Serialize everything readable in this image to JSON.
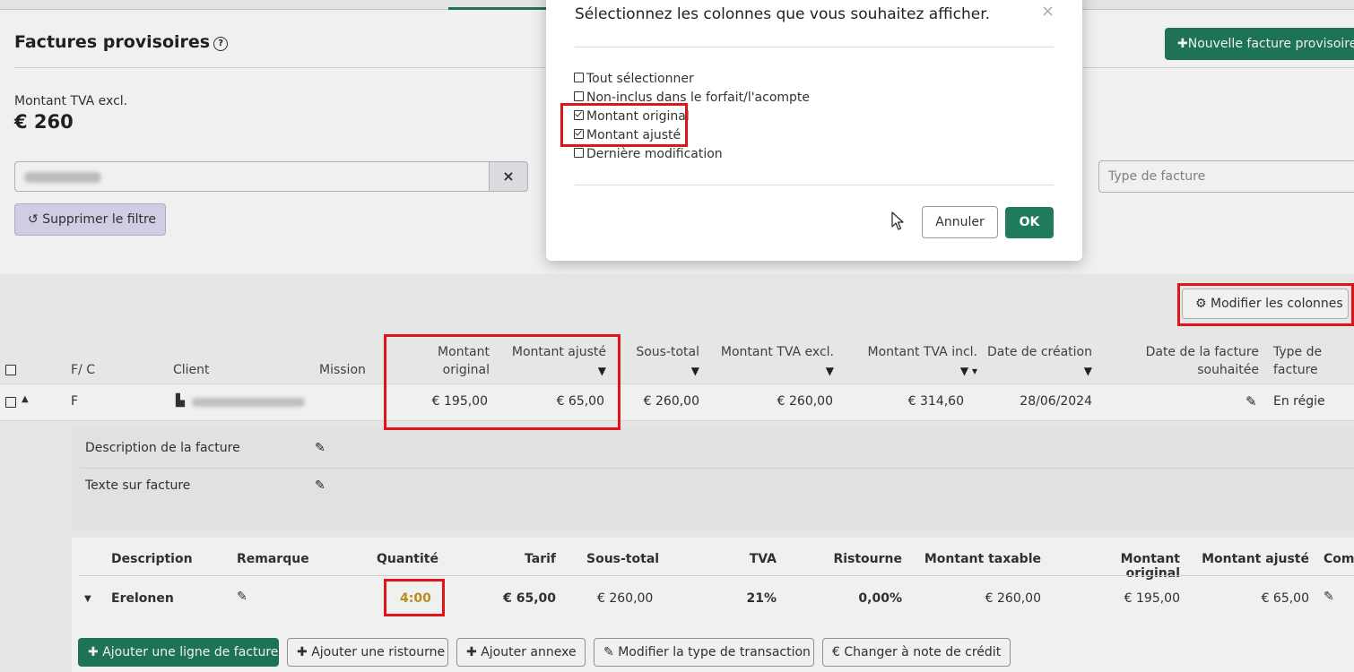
{
  "page": {
    "title": "Factures provisoires",
    "help_icon": "?",
    "new_invoice_button": "Nouvelle facture provisoire",
    "kpi_label": "Montant TVA excl.",
    "kpi_value": "€ 260",
    "filter_clear": "×",
    "remove_filter_button": "Supprimer le filtre",
    "type_placeholder": "Type de facture",
    "modify_columns_button": "Modifier les colonnes"
  },
  "table": {
    "headers": {
      "fc": "F/ C",
      "client": "Client",
      "mission": "Mission",
      "montant_original": "Montant original",
      "montant_ajuste": "Montant ajusté",
      "sous_total": "Sous-total",
      "tva_excl": "Montant TVA excl.",
      "tva_incl": "Montant TVA incl.",
      "date_creation": "Date de création",
      "date_souhaitee_1": "Date de la facture",
      "date_souhaitee_2": "souhaitée",
      "type_1": "Type de",
      "type_2": "facture"
    },
    "row": {
      "fc": "F",
      "montant_original": "€ 195,00",
      "montant_ajuste": "€ 65,00",
      "sous_total": "€ 260,00",
      "tva_excl": "€ 260,00",
      "tva_incl": "€ 314,60",
      "date_creation": "28/06/2024",
      "type": "En régie"
    }
  },
  "details": {
    "description_label": "Description de la facture",
    "text_label": "Texte sur facture"
  },
  "lines": {
    "headers": {
      "description": "Description",
      "remarque": "Remarque",
      "quantite": "Quantité",
      "tarif": "Tarif",
      "sous_total": "Sous-total",
      "tva": "TVA",
      "ristourne": "Ristourne",
      "montant_taxable": "Montant taxable",
      "montant_original": "Montant original",
      "montant_ajuste": "Montant ajusté",
      "comp": "Comp"
    },
    "row": {
      "description": "Erelonen",
      "quantite": "4:00",
      "tarif": "€ 65,00",
      "sous_total": "€ 260,00",
      "tva": "21%",
      "ristourne": "0,00%",
      "montant_taxable": "€ 260,00",
      "montant_original": "€ 195,00",
      "montant_ajuste": "€ 65,00"
    }
  },
  "actions": {
    "add_line": "Ajouter une ligne de facture",
    "add_discount": "Ajouter une ristourne",
    "add_annex": "Ajouter annexe",
    "modify_transaction": "Modifier la type de transaction",
    "credit_note": "Changer à note de crédit"
  },
  "modal": {
    "title": "Sélectionnez les colonnes que vous souhaitez afficher.",
    "close": "×",
    "options": [
      {
        "label": "Tout sélectionner",
        "checked": false
      },
      {
        "label": "Non-inclus dans le forfait/l'acompte",
        "checked": false
      },
      {
        "label": "Montant original",
        "checked": true
      },
      {
        "label": "Montant ajusté",
        "checked": true
      },
      {
        "label": "Dernière modification",
        "checked": false
      }
    ],
    "cancel": "Annuler",
    "ok": "OK"
  },
  "colors": {
    "primary": "#1f7a5e",
    "highlight": "#e0151b",
    "quantity": "#c8941e"
  }
}
